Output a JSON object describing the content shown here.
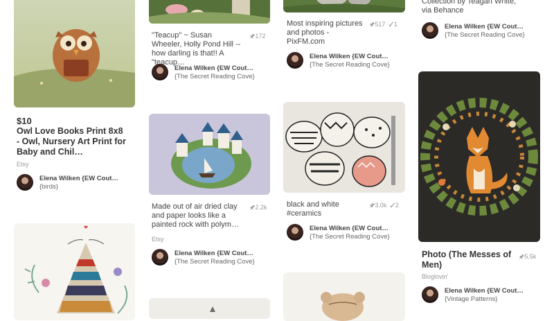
{
  "pins": [
    {
      "id": "owl",
      "price": "$10",
      "description": "Owl Love Books Print 8x8 - Owl, Nursery Art Print for Baby and Chil…",
      "source": "Etsy",
      "user": "Elena Wilken {EW Cout…",
      "board": "{birds}"
    },
    {
      "id": "teacup",
      "description": "\"Teacup\" ~ Susan Wheeler, Holly Pond Hill -- how darling is that!! A \"teacup…",
      "repins": "172",
      "user": "Elena Wilken {EW Cout…",
      "board": "{The Secret Reading Cove}"
    },
    {
      "id": "pixfm",
      "description": "Most inspiring pictures and photos - PixFM.com",
      "repins": "517",
      "likes": "1",
      "user": "Elena Wilken {EW Cout…",
      "board": "{The Secret Reading Cove}"
    },
    {
      "id": "teagan",
      "description": "Collection by Teagan White, via Behance",
      "user": "Elena Wilken {EW Cout…",
      "board": "{The Secret Reading Cove}"
    },
    {
      "id": "clay",
      "description": "Made out of air dried clay and paper looks like a painted rock with polym…",
      "repins": "2.2k",
      "source": "Etsy",
      "user": "Elena Wilken {EW Cout…",
      "board": "{The Secret Reading Cove}"
    },
    {
      "id": "ceramics",
      "description": "black and white #ceramics",
      "repins": "3.0k",
      "likes": "2",
      "user": "Elena Wilken {EW Cout…",
      "board": "{The Secret Reading Cove}"
    },
    {
      "id": "fox",
      "description": "Photo (The Messes of Men)",
      "repins": "5.5k",
      "source": "Bloglovin'",
      "user": "Elena Wilken {EW Cout…",
      "board": "{Vintage Patterns}"
    }
  ],
  "icons": {
    "repin": "pin-icon",
    "like": "check-icon"
  },
  "colors": {
    "page_background": "#ffffff",
    "text_primary": "#333333",
    "text_muted": "#999999"
  }
}
